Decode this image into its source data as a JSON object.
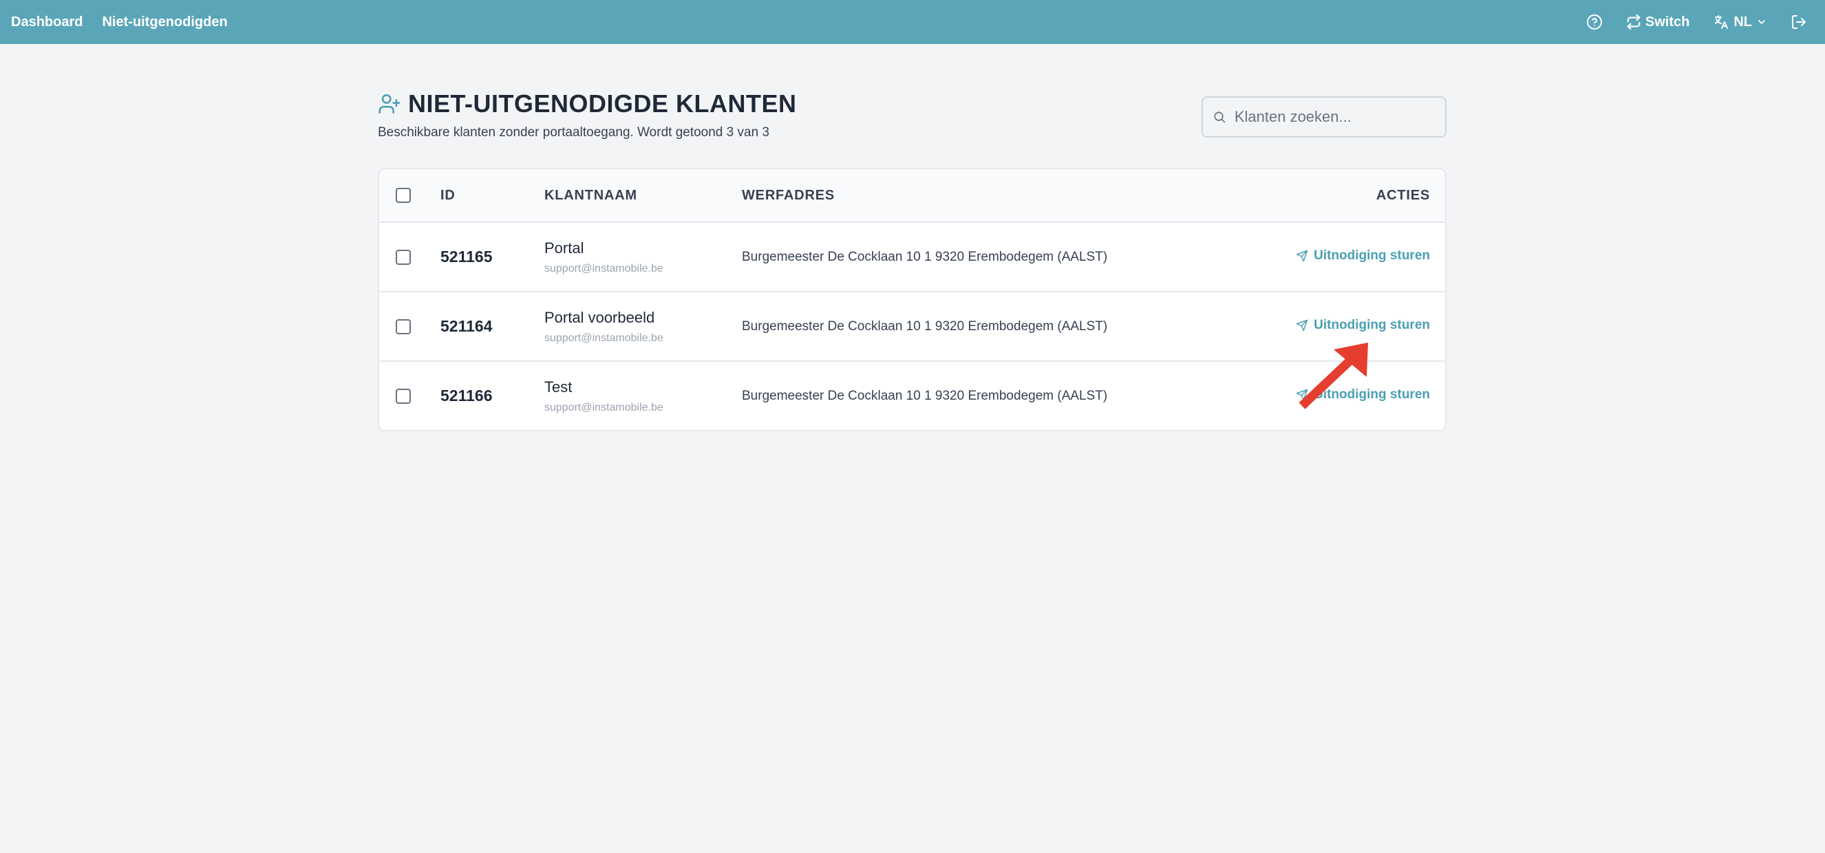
{
  "nav": {
    "dashboard": "Dashboard",
    "uninvited": "Niet-uitgenodigden",
    "switch": "Switch",
    "language": "NL"
  },
  "header": {
    "title": "NIET-UITGENODIGDE KLANTEN",
    "subtitle": "Beschikbare klanten zonder portaaltoegang. Wordt getoond 3 van 3"
  },
  "search": {
    "placeholder": "Klanten zoeken..."
  },
  "table": {
    "columns": [
      "ID",
      "KLANTNAAM",
      "WERFADRES",
      "ACTIES"
    ],
    "rows": [
      {
        "id": "521165",
        "name": "Portal",
        "email": "support@instamobile.be",
        "address": "Burgemeester De Cocklaan 10 1 9320 Erembodegem (AALST)",
        "action": "Uitnodiging sturen"
      },
      {
        "id": "521164",
        "name": "Portal voorbeeld",
        "email": "support@instamobile.be",
        "address": "Burgemeester De Cocklaan 10 1 9320 Erembodegem (AALST)",
        "action": "Uitnodiging sturen"
      },
      {
        "id": "521166",
        "name": "Test",
        "email": "support@instamobile.be",
        "address": "Burgemeester De Cocklaan 10 1 9320 Erembodegem (AALST)",
        "action": "Uitnodiging sturen"
      }
    ]
  },
  "colors": {
    "topbar": "#5aa6b8",
    "accent": "#4a9fb3",
    "annotation_arrow": "#e53e2f"
  }
}
